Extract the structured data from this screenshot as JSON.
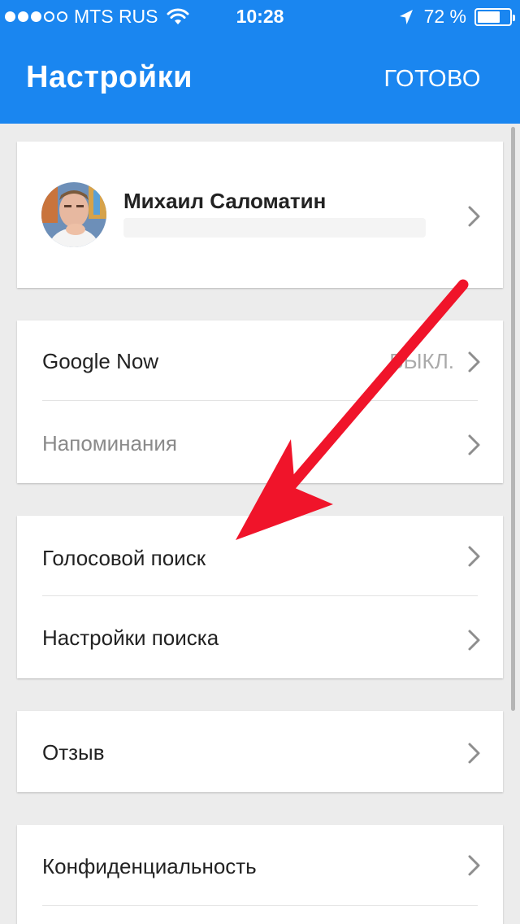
{
  "status_bar": {
    "carrier": "MTS RUS",
    "time": "10:28",
    "battery_percent": "72 %",
    "battery_level": 0.72,
    "signal_bars": 3,
    "signal_total": 5
  },
  "header": {
    "title": "Настройки",
    "done_label": "ГОТОВО",
    "color": "#1a86f0"
  },
  "profile": {
    "name": "Михаил Саломатин"
  },
  "groups": {
    "google_now_label": "Google Now",
    "google_now_value": "ВЫКЛ.",
    "reminders_label": "Напоминания",
    "voice_search_label": "Голосовой поиск",
    "search_settings_label": "Настройки поиска",
    "feedback_label": "Отзыв",
    "privacy_label": "Конфиденциальность"
  },
  "annotation": {
    "arrow_color": "#f0142a"
  }
}
